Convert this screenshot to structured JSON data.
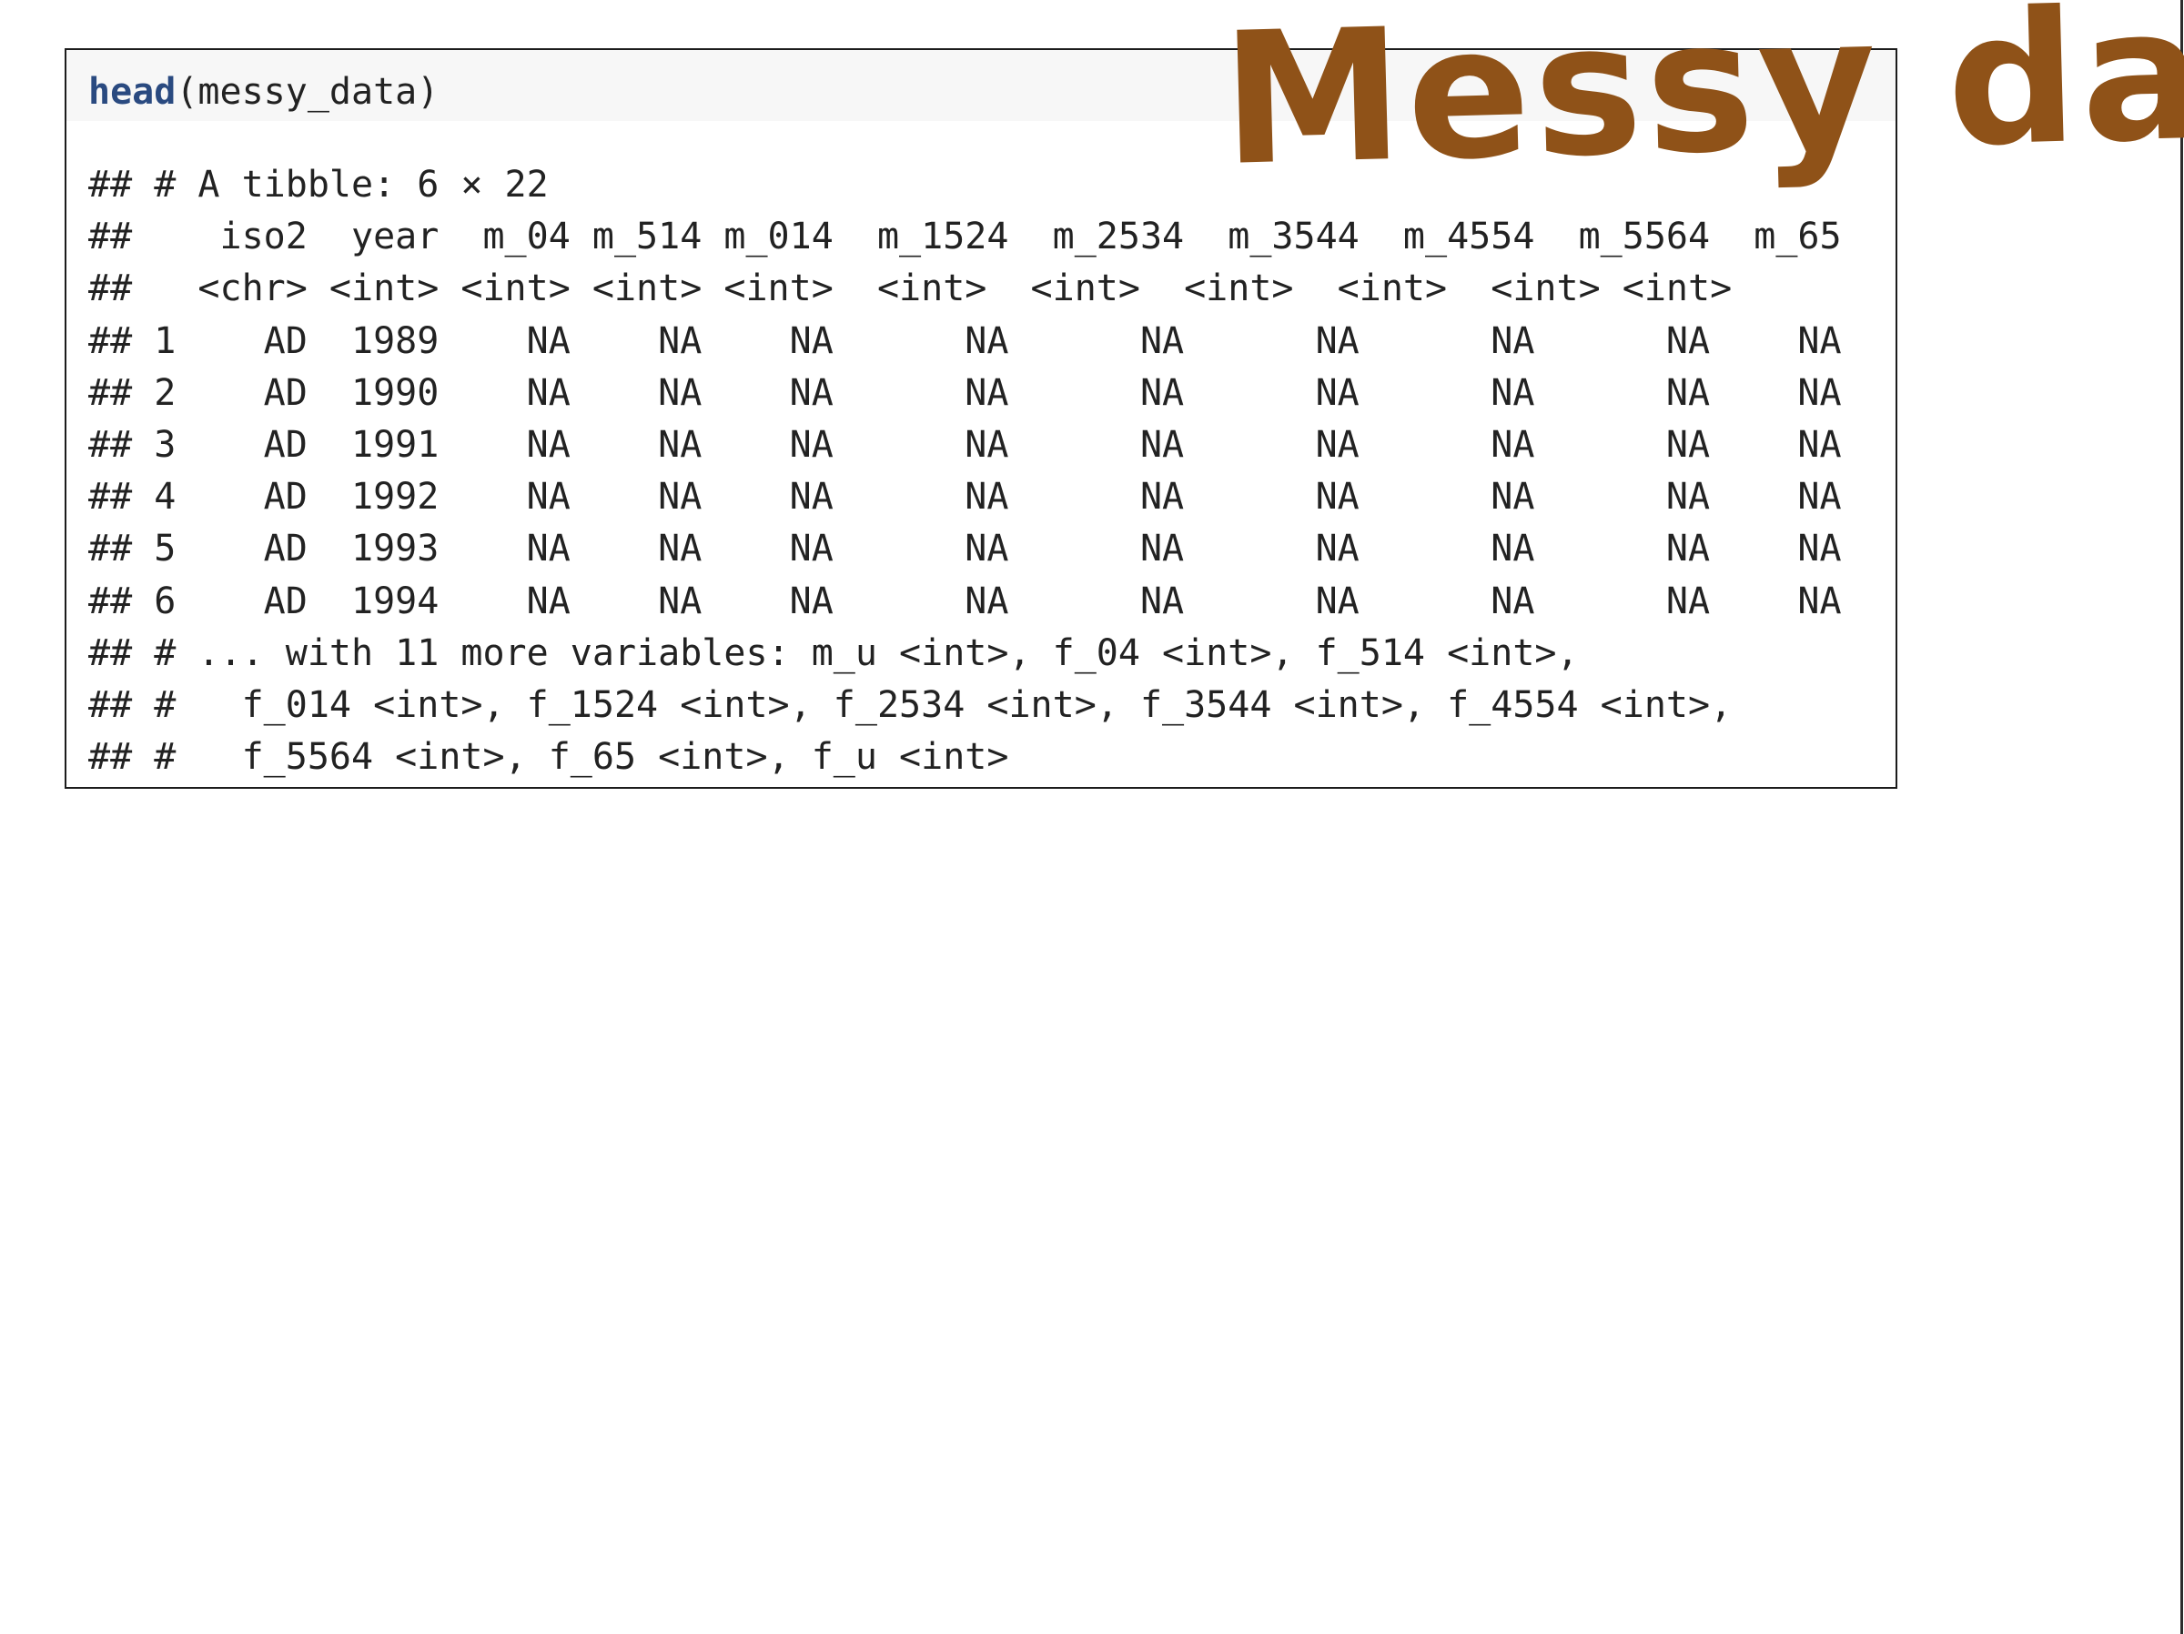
{
  "slide": {
    "title": "Messy data",
    "accent_color": "#8f5218"
  },
  "code_chunk": {
    "function_name": "head",
    "arguments": "(messy_data)",
    "output_lines": [
      "## # A tibble: 6 × 22",
      "##    iso2  year  m_04 m_514 m_014  m_1524  m_2534  m_3544  m_4554  m_5564  m_65",
      "##   <chr> <int> <int> <int> <int>  <int>  <int>  <int>  <int>  <int> <int>",
      "## 1    AD  1989    NA    NA    NA      NA      NA      NA      NA      NA    NA",
      "## 2    AD  1990    NA    NA    NA      NA      NA      NA      NA      NA    NA",
      "## 3    AD  1991    NA    NA    NA      NA      NA      NA      NA      NA    NA",
      "## 4    AD  1992    NA    NA    NA      NA      NA      NA      NA      NA    NA",
      "## 5    AD  1993    NA    NA    NA      NA      NA      NA      NA      NA    NA",
      "## 6    AD  1994    NA    NA    NA      NA      NA      NA      NA      NA    NA",
      "## # ... with 11 more variables: m_u <int>, f_04 <int>, f_514 <int>,",
      "## #   f_014 <int>, f_1524 <int>, f_2534 <int>, f_3544 <int>, f_4554 <int>,",
      "## #   f_5564 <int>, f_65 <int>, f_u <int>"
    ]
  }
}
